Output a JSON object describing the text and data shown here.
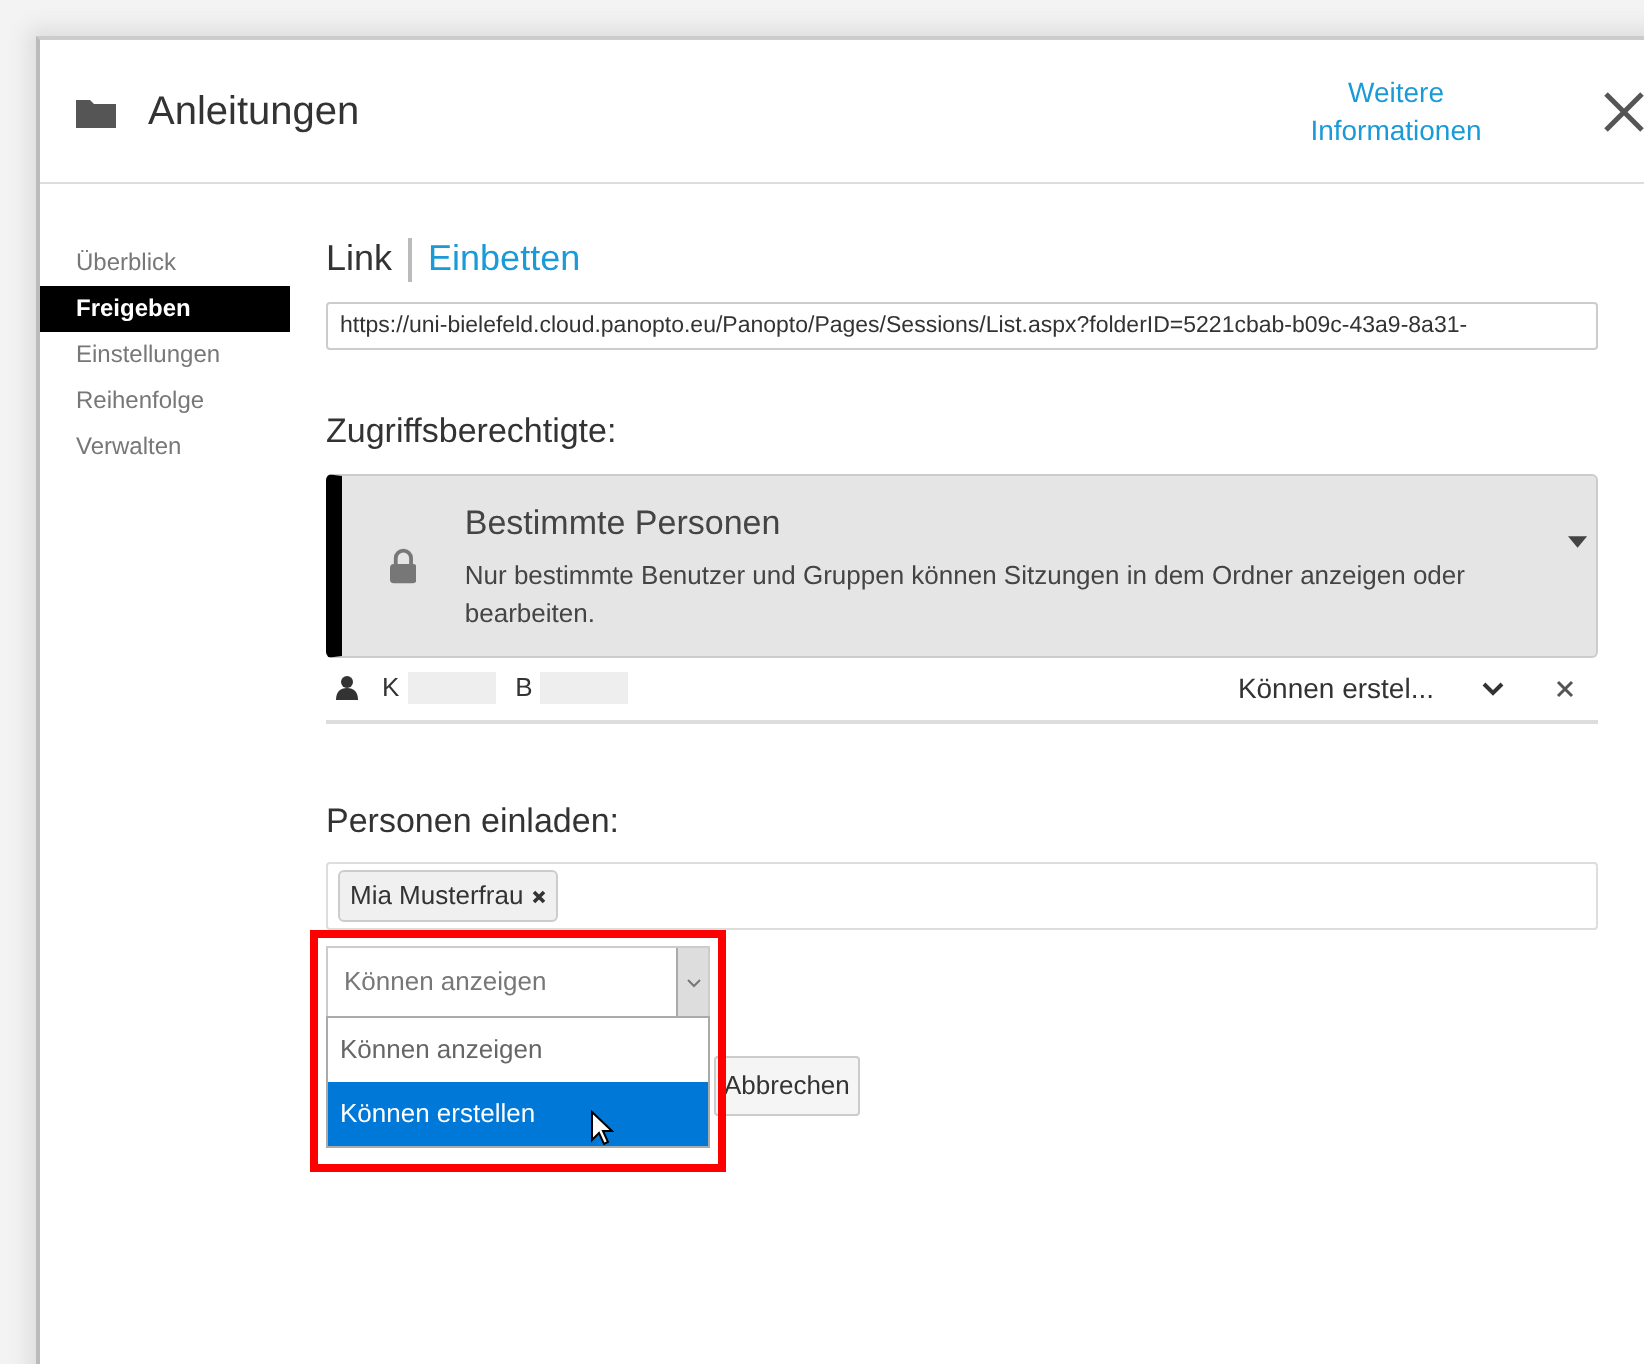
{
  "dialog": {
    "title": "Anleitungen",
    "info_link": "Weitere Informationen"
  },
  "sidebar": {
    "items": [
      {
        "label": "Überblick",
        "selected": false
      },
      {
        "label": "Freigeben",
        "selected": true
      },
      {
        "label": "Einstellungen",
        "selected": false
      },
      {
        "label": "Reihenfolge",
        "selected": false
      },
      {
        "label": "Verwalten",
        "selected": false
      }
    ]
  },
  "share_tabs": [
    {
      "label": "Link",
      "selected": true
    },
    {
      "label": "Einbetten",
      "selected": false
    }
  ],
  "url_field": {
    "value": "https://uni-bielefeld.cloud.panopto.eu/Panopto/Pages/Sessions/List.aspx?folderID=5221cbab-b09c-43a9-8a31-"
  },
  "access": {
    "heading": "Zugriffsberechtigte:",
    "option": {
      "title": "Bestimmte Personen",
      "description": "Nur bestimmte Benutzer und Gruppen können Sitzungen in dem Ordner anzeigen oder bearbeiten."
    },
    "members": [
      {
        "name_parts": [
          "K",
          "B"
        ],
        "role": "Können erstel..."
      }
    ]
  },
  "invite": {
    "heading": "Personen einladen:",
    "tags": [
      "Mia Musterfrau"
    ],
    "role_select": {
      "value": "Können anzeigen",
      "expanded": true,
      "options": [
        {
          "label": "Können anzeigen",
          "highlighted": false
        },
        {
          "label": "Können erstellen",
          "highlighted": true
        }
      ]
    },
    "buttons": [
      "Abbrechen"
    ],
    "highlight_box": true
  }
}
